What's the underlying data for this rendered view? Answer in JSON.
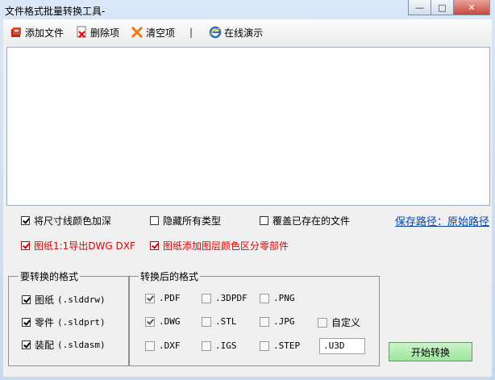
{
  "window": {
    "title": "文件格式批量转换工具-"
  },
  "toolbar": {
    "add_file": "添加文件",
    "delete_item": "删除项",
    "clear_items": "清空项",
    "separator": "|",
    "online_demo": "在线演示"
  },
  "options": {
    "dimension_color": {
      "label": "将尺寸线颜色加深",
      "checked": true
    },
    "hide_types": {
      "label": "隐藏所有类型",
      "checked": false
    },
    "overwrite": {
      "label": "覆盖已存在的文件",
      "checked": false
    },
    "save_path": "保存路径：原始路径",
    "export_dwg": {
      "label": "图纸1:1导出DWG DXF",
      "checked": true
    },
    "layer_colors": {
      "label": "图纸添加图层颜色区分零部件",
      "checked": true
    }
  },
  "source_formats": {
    "title": "要转换的格式",
    "items": [
      {
        "name": "图纸",
        "ext": "(.slddrw)",
        "checked": true
      },
      {
        "name": "零件",
        "ext": "(.sldprt)",
        "checked": true
      },
      {
        "name": "装配",
        "ext": "(.sldasm)",
        "checked": true
      }
    ]
  },
  "target_formats": {
    "title": "转换后的格式",
    "items": [
      {
        "label": ".PDF",
        "checked": true
      },
      {
        "label": ".3DPDF",
        "checked": false
      },
      {
        "label": ".PNG",
        "checked": false
      },
      {
        "label": ".DWG",
        "checked": true
      },
      {
        "label": ".STL",
        "checked": false
      },
      {
        "label": ".JPG",
        "checked": false
      },
      {
        "label": "自定义",
        "checked": false
      },
      {
        "label": ".DXF",
        "checked": false
      },
      {
        "label": ".IGS",
        "checked": false
      },
      {
        "label": ".STEP",
        "checked": false
      }
    ],
    "custom_value": ".U3D"
  },
  "start_button": "开始转换",
  "colors": {
    "accent_red": "#e00000",
    "link_blue": "#0645ad",
    "start_green": "#a8eaa8"
  }
}
